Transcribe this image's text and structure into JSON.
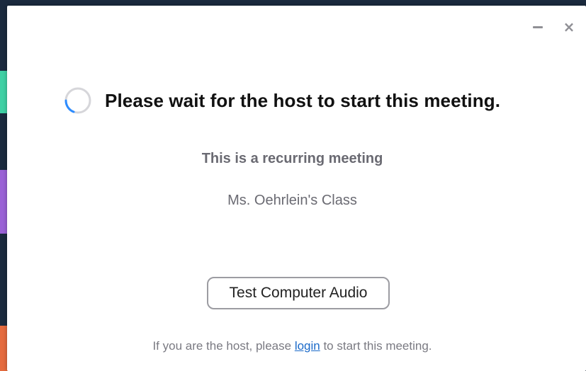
{
  "window": {
    "title": "Please wait for the host to start this meeting.",
    "minimize_icon": "minimize-icon",
    "close_icon": "close-icon",
    "close_glyph": "×"
  },
  "meeting": {
    "recurring_label": "This is a recurring meeting",
    "name": "Ms. Oehrlein's Class"
  },
  "actions": {
    "test_audio_label": "Test Computer Audio"
  },
  "footer": {
    "prefix": "If you are the host, please ",
    "login_link": "login",
    "suffix": " to start this meeting."
  },
  "colors": {
    "spinner_track": "#d6d6da",
    "spinner_arc": "#2d8cff",
    "link": "#1b6ac9",
    "text_muted": "#6a6a72"
  }
}
